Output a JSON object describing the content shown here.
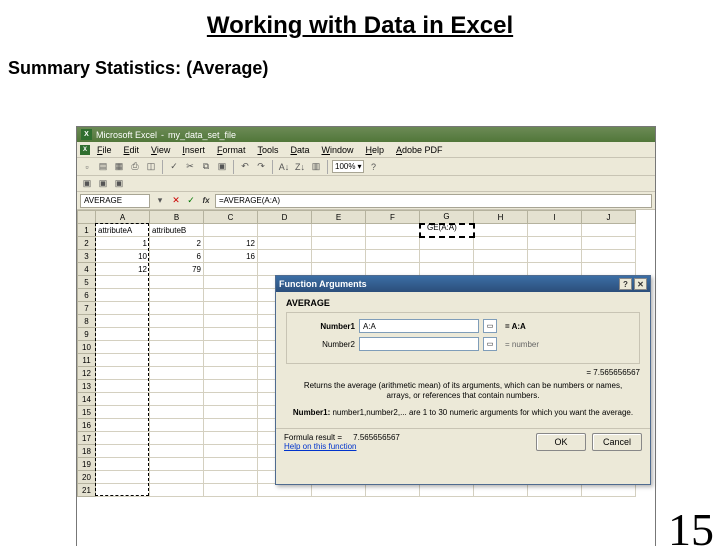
{
  "slide": {
    "title": "Working with Data in Excel",
    "subtitle": "Summary Statistics: (Average)",
    "page_number": "15"
  },
  "window": {
    "app_name": "Microsoft Excel",
    "doc_name": "my_data_set_file",
    "menus": [
      "File",
      "Edit",
      "View",
      "Insert",
      "Format",
      "Tools",
      "Data",
      "Window",
      "Help",
      "Adobe PDF"
    ],
    "zoom": "100%",
    "namebox": "AVERAGE",
    "formula": "=AVERAGE(A:A)",
    "columns": [
      "A",
      "B",
      "C",
      "D",
      "E",
      "F",
      "G",
      "H",
      "I",
      "J"
    ],
    "g1_display": "GE(A:A)",
    "rows": [
      {
        "n": "1",
        "cells": [
          "attributeA",
          "attributeB",
          "",
          "",
          "",
          "",
          "",
          "",
          "",
          ""
        ],
        "left": true
      },
      {
        "n": "2",
        "cells": [
          "1",
          "2",
          "12",
          "",
          "",
          "",
          "",
          "",
          "",
          ""
        ]
      },
      {
        "n": "3",
        "cells": [
          "10",
          "6",
          "16",
          "",
          "",
          "",
          "",
          "",
          "",
          ""
        ]
      },
      {
        "n": "4",
        "cells": [
          "12",
          "79",
          "",
          "",
          "",
          "",
          "",
          "",
          "",
          ""
        ]
      },
      {
        "n": "5",
        "cells": [
          "",
          "",
          "",
          "",
          "",
          "",
          "",
          "",
          "",
          ""
        ]
      },
      {
        "n": "6",
        "cells": [
          "",
          "",
          "",
          "",
          "",
          "",
          "",
          "",
          "",
          ""
        ]
      },
      {
        "n": "7",
        "cells": [
          "",
          "",
          "",
          "",
          "",
          "",
          "",
          "",
          "",
          ""
        ]
      },
      {
        "n": "8",
        "cells": [
          "",
          "",
          "",
          "",
          "",
          "",
          "",
          "",
          "",
          ""
        ]
      },
      {
        "n": "9",
        "cells": [
          "",
          "",
          "",
          "",
          "",
          "",
          "",
          "",
          "",
          ""
        ]
      },
      {
        "n": "10",
        "cells": [
          "",
          "",
          "",
          "",
          "",
          "",
          "",
          "",
          "",
          ""
        ]
      },
      {
        "n": "11",
        "cells": [
          "",
          "",
          "",
          "",
          "",
          "",
          "",
          "",
          "",
          ""
        ]
      },
      {
        "n": "12",
        "cells": [
          "",
          "",
          "",
          "",
          "",
          "",
          "",
          "",
          "",
          ""
        ]
      },
      {
        "n": "13",
        "cells": [
          "",
          "",
          "",
          "",
          "",
          "",
          "",
          "",
          "",
          ""
        ]
      },
      {
        "n": "14",
        "cells": [
          "",
          "",
          "",
          "",
          "",
          "",
          "",
          "",
          "",
          ""
        ]
      },
      {
        "n": "15",
        "cells": [
          "",
          "",
          "",
          "",
          "",
          "",
          "",
          "",
          "",
          ""
        ]
      },
      {
        "n": "16",
        "cells": [
          "",
          "",
          "",
          "",
          "",
          "",
          "",
          "",
          "",
          ""
        ]
      },
      {
        "n": "17",
        "cells": [
          "",
          "",
          "",
          "",
          "",
          "",
          "",
          "",
          "",
          ""
        ]
      },
      {
        "n": "18",
        "cells": [
          "",
          "",
          "",
          "",
          "",
          "",
          "",
          "",
          "",
          ""
        ]
      },
      {
        "n": "19",
        "cells": [
          "",
          "",
          "",
          "",
          "",
          "",
          "",
          "",
          "",
          ""
        ]
      },
      {
        "n": "20",
        "cells": [
          "",
          "",
          "",
          "",
          "",
          "",
          "",
          "",
          "",
          ""
        ]
      },
      {
        "n": "21",
        "cells": [
          "",
          "",
          "",
          "",
          "",
          "",
          "",
          "",
          "",
          ""
        ]
      }
    ]
  },
  "dialog": {
    "title": "Function Arguments",
    "fn": "AVERAGE",
    "arg1_label": "Number1",
    "arg1_value": "A:A",
    "arg1_hint": "= A:A",
    "arg2_label": "Number2",
    "arg2_value": "",
    "arg2_hint": "= number",
    "current_result": "= 7.565656567",
    "description": "Returns the average (arithmetic mean) of its arguments, which can be numbers or names, arrays, or references that contain numbers.",
    "arg_desc_label": "Number1:",
    "arg_desc": "number1,number2,... are 1 to 30 numeric arguments for which you want the average.",
    "formula_result_label": "Formula result =",
    "formula_result_value": "7.565656567",
    "help": "Help on this function",
    "ok": "OK",
    "cancel": "Cancel"
  }
}
